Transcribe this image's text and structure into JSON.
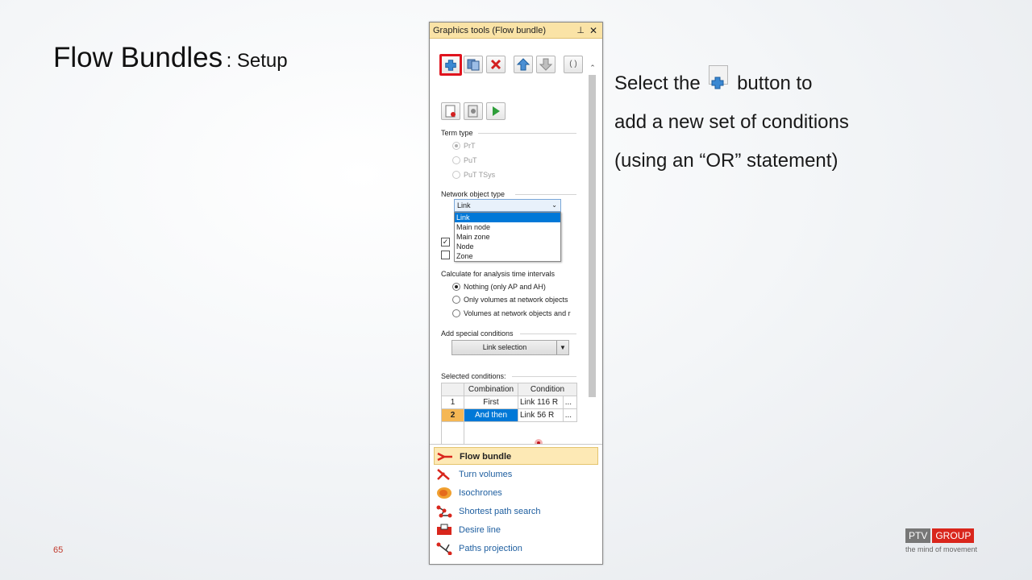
{
  "slide": {
    "title_main": "Flow Bundles",
    "title_sub": ": Setup",
    "page_number": "65"
  },
  "explain": {
    "line1_pre": "Select the",
    "line1_post": "button to",
    "line2": "add a new set of conditions",
    "line3": "(using an “OR” statement)"
  },
  "logo": {
    "ptv": "PTV",
    "group": "GROUP",
    "tagline": "the mind of movement"
  },
  "panel": {
    "title": "Graphics tools (Flow bundle)",
    "pin": "ᵖ",
    "close": "✕",
    "toolbar": {
      "add_icon": "plus-icon",
      "copy_icon": "copy-icon",
      "delete_icon": "delete-icon",
      "up_icon": "arrow-up-icon",
      "down_icon": "arrow-down-icon",
      "braces": "( )"
    },
    "term_type": {
      "label": "Term type",
      "options": [
        "PrT",
        "PuT",
        "PuT TSys"
      ]
    },
    "network_object_type": {
      "label": "Network object type",
      "selected": "Link",
      "options": [
        "Link",
        "Main node",
        "Main zone",
        "Node",
        "Zone"
      ]
    },
    "analysis": {
      "label": "Calculate for analysis time intervals",
      "options": [
        "Nothing (only AP and AH)",
        "Only volumes at network objects",
        "Volumes at network objects and r"
      ]
    },
    "special": {
      "label": "Add special conditions",
      "button": "Link selection"
    },
    "selected_conditions": {
      "label": "Selected conditions:",
      "headers": [
        "",
        "Combination",
        "Condition"
      ],
      "rows": [
        {
          "n": "1",
          "combination": "First",
          "condition": "Link 116 R",
          "more": "..."
        },
        {
          "n": "2",
          "combination": "And then",
          "condition": "Link 56 R",
          "more": "..."
        }
      ]
    },
    "tools": [
      {
        "label": "Flow bundle",
        "icon": "flow-bundle-icon"
      },
      {
        "label": "Turn volumes",
        "icon": "turn-volumes-icon"
      },
      {
        "label": "Isochrones",
        "icon": "isochrones-icon"
      },
      {
        "label": "Shortest path search",
        "icon": "shortest-path-icon"
      },
      {
        "label": "Desire line",
        "icon": "desire-line-icon"
      },
      {
        "label": "Paths projection",
        "icon": "paths-projection-icon"
      }
    ]
  },
  "colors": {
    "highlight": "#e0141e",
    "selection": "#0078d7",
    "active_row": "#f5b754",
    "title_bar": "#fae3a6"
  }
}
